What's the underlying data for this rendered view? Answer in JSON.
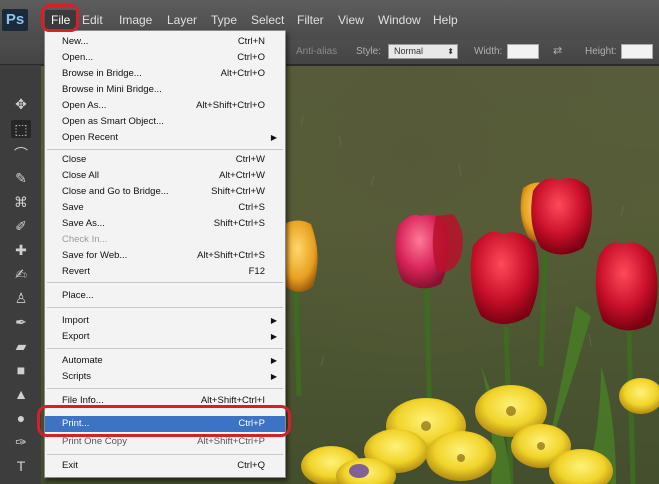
{
  "app": {
    "logo": "Ps"
  },
  "menubar": {
    "items": [
      "File",
      "Edit",
      "Image",
      "Layer",
      "Type",
      "Select",
      "Filter",
      "View",
      "Window",
      "Help"
    ]
  },
  "options": {
    "anti_alias": "Anti-alias",
    "style_label": "Style:",
    "style_value": "Normal",
    "width_label": "Width:",
    "height_label": "Height:"
  },
  "tools": [
    "move-icon",
    "marquee-icon",
    "lasso-icon",
    "quick-selection-icon",
    "crop-icon",
    "eyedropper-icon",
    "healing-brush-icon",
    "brush-icon",
    "clone-stamp-icon",
    "history-brush-icon",
    "eraser-icon",
    "gradient-icon",
    "blur-icon",
    "dodge-icon",
    "pen-icon",
    "type-icon"
  ],
  "file_menu": {
    "items": [
      {
        "label": "New...",
        "shortcut": "Ctrl+N"
      },
      {
        "label": "Open...",
        "shortcut": "Ctrl+O"
      },
      {
        "label": "Browse in Bridge...",
        "shortcut": "Alt+Ctrl+O"
      },
      {
        "label": "Browse in Mini Bridge...",
        "shortcut": ""
      },
      {
        "label": "Open As...",
        "shortcut": "Alt+Shift+Ctrl+O"
      },
      {
        "label": "Open as Smart Object...",
        "shortcut": ""
      },
      {
        "label": "Open Recent",
        "shortcut": ""
      },
      {
        "label": "Close",
        "shortcut": "Ctrl+W"
      },
      {
        "label": "Close All",
        "shortcut": "Alt+Ctrl+W"
      },
      {
        "label": "Close and Go to Bridge...",
        "shortcut": "Shift+Ctrl+W"
      },
      {
        "label": "Save",
        "shortcut": "Ctrl+S"
      },
      {
        "label": "Save As...",
        "shortcut": "Shift+Ctrl+S"
      },
      {
        "label": "Check In...",
        "shortcut": ""
      },
      {
        "label": "Save for Web...",
        "shortcut": "Alt+Shift+Ctrl+S"
      },
      {
        "label": "Revert",
        "shortcut": "F12"
      },
      {
        "label": "Place...",
        "shortcut": ""
      },
      {
        "label": "Import",
        "shortcut": ""
      },
      {
        "label": "Export",
        "shortcut": ""
      },
      {
        "label": "Automate",
        "shortcut": ""
      },
      {
        "label": "Scripts",
        "shortcut": ""
      },
      {
        "label": "File Info...",
        "shortcut": "Alt+Shift+Ctrl+I"
      },
      {
        "label": "Print...",
        "shortcut": "Ctrl+P"
      },
      {
        "label": "Print One Copy",
        "shortcut": "Alt+Shift+Ctrl+P"
      },
      {
        "label": "Exit",
        "shortcut": "Ctrl+Q"
      }
    ]
  },
  "colors": {
    "highlight_blue": "#3c73c4",
    "callout_red": "#d4202a"
  }
}
